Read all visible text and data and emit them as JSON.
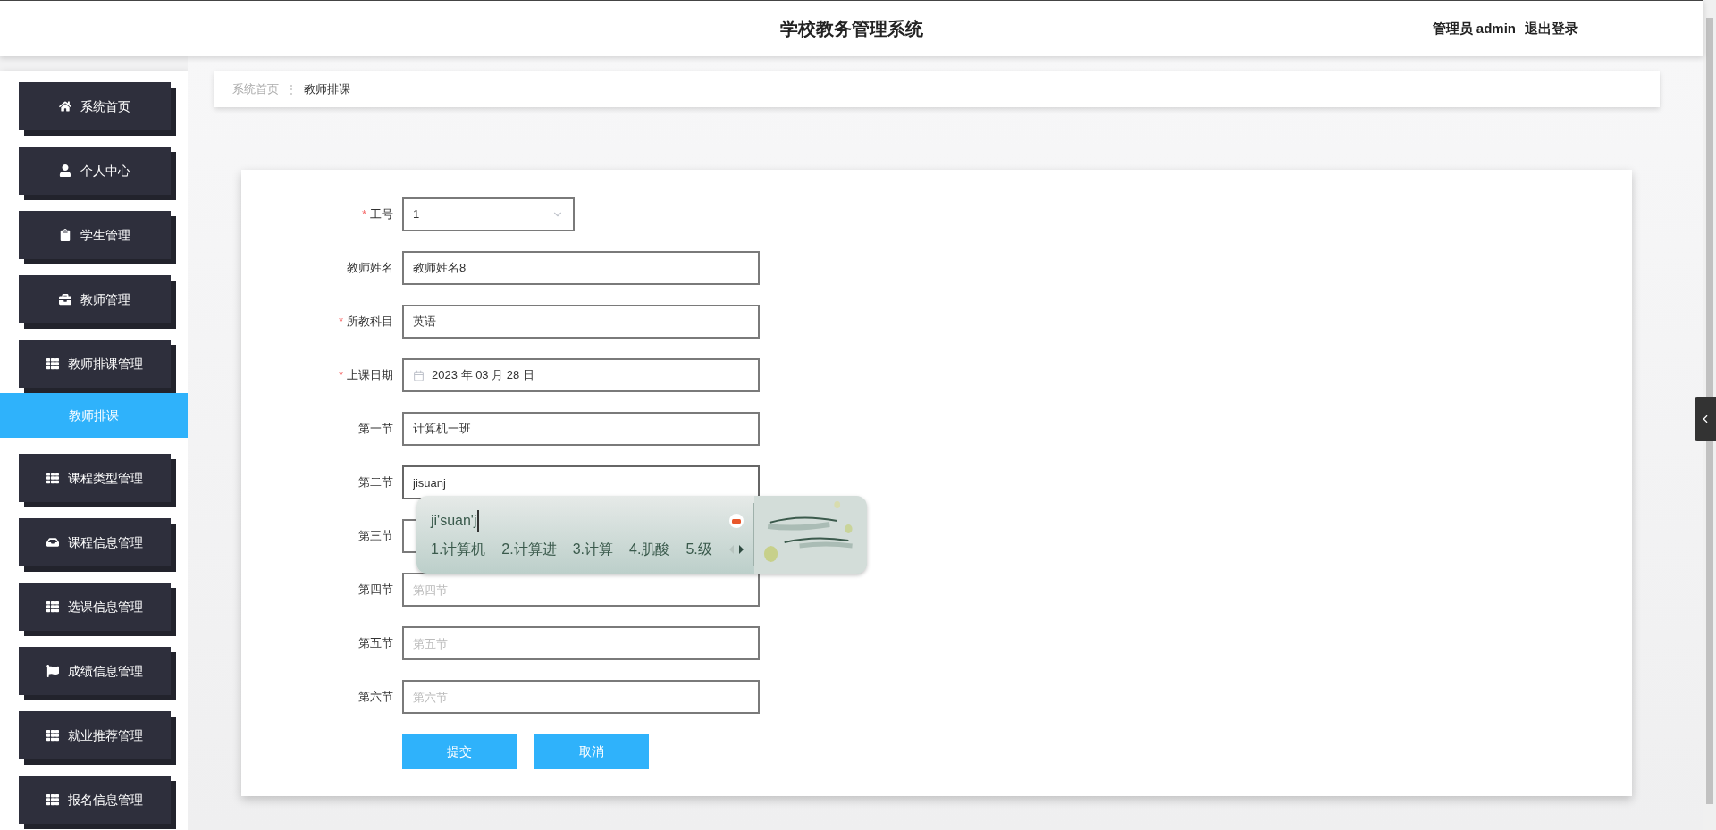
{
  "header": {
    "title": "学校教务管理系统",
    "user": "管理员 admin",
    "logout": "退出登录"
  },
  "sidebar": {
    "items": [
      {
        "label": "系统首页"
      },
      {
        "label": "个人中心"
      },
      {
        "label": "学生管理"
      },
      {
        "label": "教师管理"
      },
      {
        "label": "教师排课管理",
        "children": [
          {
            "label": "教师排课",
            "selected": true
          }
        ]
      },
      {
        "label": "课程类型管理"
      },
      {
        "label": "课程信息管理"
      },
      {
        "label": "选课信息管理"
      },
      {
        "label": "成绩信息管理"
      },
      {
        "label": "就业推荐管理"
      },
      {
        "label": "报名信息管理"
      }
    ]
  },
  "breadcrumb_separator": "⋮",
  "breadcrumb": [
    {
      "label": "系统首页",
      "current": false
    },
    {
      "label": "教师排课",
      "current": true
    }
  ],
  "form": {
    "required_mark": "*",
    "fields": [
      {
        "kind": "select",
        "label": "工号",
        "required": true,
        "value": "1"
      },
      {
        "kind": "text",
        "label": "教师姓名",
        "required": false,
        "value": "教师姓名8"
      },
      {
        "kind": "text",
        "label": "所教科目",
        "required": true,
        "value": "英语"
      },
      {
        "kind": "date",
        "label": "上课日期",
        "required": true,
        "value": "2023 年 03 月 28 日"
      },
      {
        "kind": "text",
        "label": "第一节",
        "required": false,
        "value": "计算机一班"
      },
      {
        "kind": "text",
        "label": "第二节",
        "required": false,
        "value": "jisuanj",
        "focused": true
      },
      {
        "kind": "text",
        "label": "第三节",
        "required": false
      },
      {
        "kind": "text",
        "label": "第四节",
        "required": false,
        "placeholder": "第四节"
      },
      {
        "kind": "text",
        "label": "第五节",
        "required": false,
        "placeholder": "第五节"
      },
      {
        "kind": "text",
        "label": "第六节",
        "required": false,
        "placeholder": "第六节"
      }
    ],
    "buttons": [
      "提交",
      "取消"
    ]
  },
  "ime": {
    "composition": "ji'suan'j",
    "candidates": [
      "1.计算机",
      "2.计算进",
      "3.计算",
      "4.肌酸",
      "5.级"
    ]
  }
}
